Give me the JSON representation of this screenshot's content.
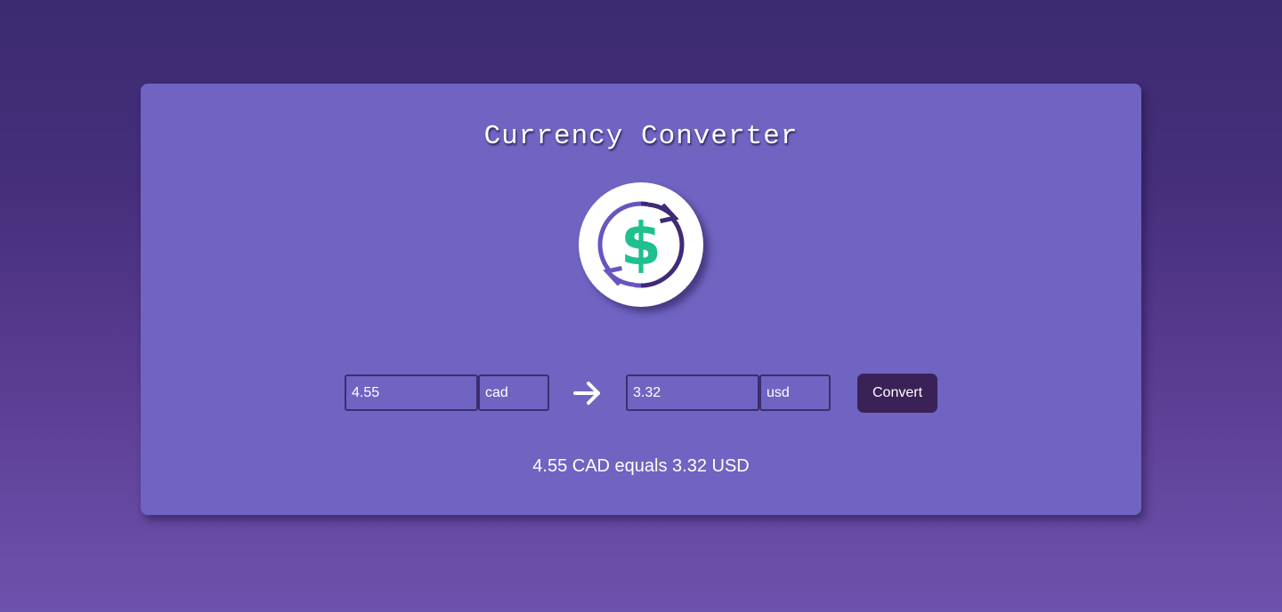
{
  "app": {
    "title": "Currency Converter",
    "logo_icon": "currency-exchange-dollar-icon"
  },
  "converter": {
    "from_amount": "4.55",
    "from_currency": "cad",
    "arrow_icon": "arrow-right-icon",
    "to_amount": "3.32",
    "to_currency": "usd",
    "convert_label": "Convert",
    "result_text": "4.55 CAD equals 3.32 USD"
  },
  "colors": {
    "background_top": "#3c2b70",
    "background_bottom": "#6d52ad",
    "card": "#6f64c2",
    "field_border": "#3d2c6e",
    "button": "#3a2157",
    "dollar_green": "#1fc08f",
    "ring_dark": "#3f2a78",
    "ring_light": "#6a55bf"
  }
}
